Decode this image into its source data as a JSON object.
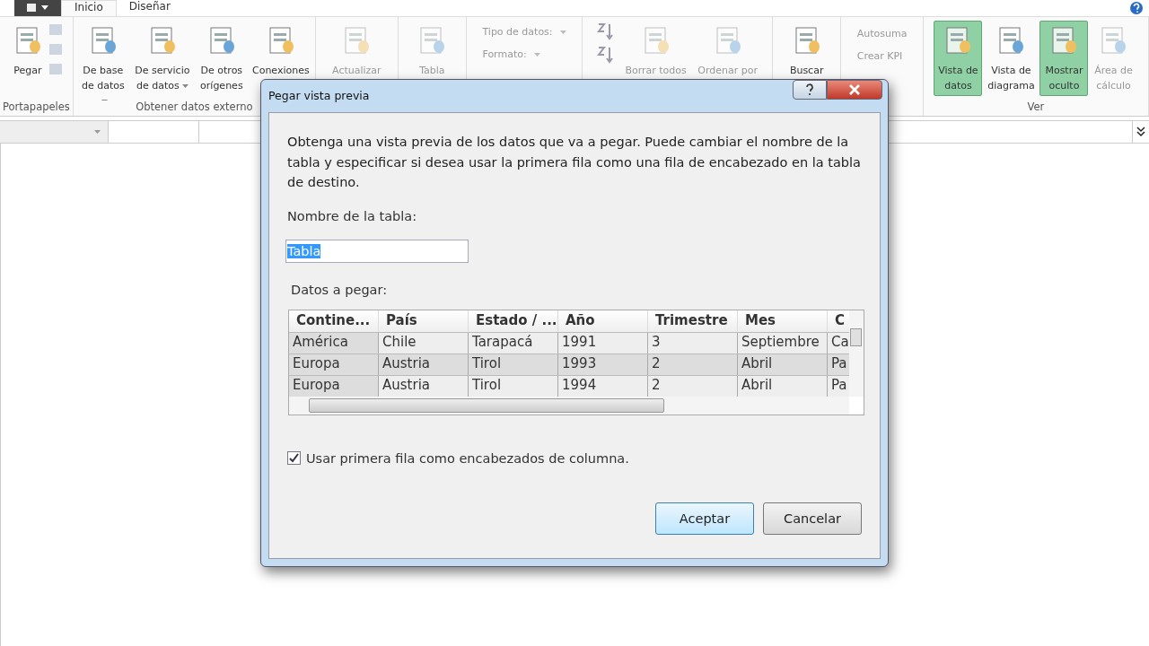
{
  "tabs": [
    {
      "label": "Inicio",
      "selected": true
    },
    {
      "label": "Diseñar",
      "selected": false
    }
  ],
  "ribbon_groups": [
    {
      "label": "Portapapeles",
      "items": [
        {
          "kind": "large",
          "label": "Pegar",
          "disabled": false
        },
        {
          "kind": "stack",
          "disabled": true
        }
      ]
    },
    {
      "label": "Obtener datos externo",
      "items": [
        {
          "kind": "large",
          "label": "De base de datos",
          "disabled": false,
          "dropdown": true
        },
        {
          "kind": "large",
          "label": "De servicio de datos",
          "disabled": false,
          "dropdown": true
        },
        {
          "kind": "large",
          "label": "De otros orígenes",
          "disabled": false
        },
        {
          "kind": "large",
          "label": "Conexiones",
          "disabled": false
        }
      ]
    },
    {
      "items": [
        {
          "kind": "large",
          "label": "Actualizar",
          "disabled": true
        }
      ]
    },
    {
      "items": [
        {
          "kind": "large",
          "label": "Tabla",
          "disabled": true
        }
      ]
    },
    {
      "items": [
        {
          "kind": "fields",
          "labels": [
            "Tipo de datos:",
            "Formato:"
          ],
          "disabled": true
        }
      ]
    },
    {
      "items": [
        {
          "kind": "sort",
          "disabled": true
        },
        {
          "kind": "large",
          "label": "Borrar todos",
          "disabled": true
        },
        {
          "kind": "large",
          "label": "Ordenar por",
          "disabled": true
        }
      ]
    },
    {
      "items": [
        {
          "kind": "large",
          "label": "Buscar",
          "disabled": false
        }
      ]
    },
    {
      "items": [
        {
          "kind": "small",
          "labels": [
            "Autosuma",
            "Crear KPI"
          ],
          "disabled": true
        }
      ]
    },
    {
      "label": "Ver",
      "items": [
        {
          "kind": "large",
          "label": "Vista de datos",
          "disabled": false,
          "selected": true
        },
        {
          "kind": "large",
          "label": "Vista de diagrama",
          "disabled": false,
          "selected": false
        },
        {
          "kind": "large",
          "label": "Mostrar oculto",
          "disabled": false,
          "selected": true
        },
        {
          "kind": "large",
          "label": "Área de cálculo",
          "disabled": true,
          "selected": false
        }
      ]
    }
  ],
  "dialog": {
    "title": "Pegar vista previa",
    "description": "Obtenga una vista previa de los datos que va a pegar. Puede cambiar el nombre de la tabla y especificar si desea usar la primera fila como una fila de encabezado en la tabla de destino.",
    "name_label": "Nombre de la tabla:",
    "name_value": "Tabla",
    "data_label": "Datos a pegar:",
    "columns": [
      "Contine...",
      "País",
      "Estado / ...",
      "Año",
      "Trimestre",
      "Mes",
      "C"
    ],
    "rows": [
      [
        "América",
        "Chile",
        "Tarapacá",
        "1991",
        "3",
        "Septiembre",
        "Ca"
      ],
      [
        "Europa",
        "Austria",
        "Tirol",
        "1993",
        "2",
        "Abril",
        "Pa"
      ],
      [
        "Europa",
        "Austria",
        "Tirol",
        "1994",
        "2",
        "Abril",
        "Pa"
      ]
    ],
    "header_checkbox": {
      "label": "Usar primera fila como encabezados de columna.",
      "checked": true
    },
    "buttons": [
      {
        "label": "Aceptar",
        "default": true
      },
      {
        "label": "Cancelar",
        "default": false
      }
    ]
  }
}
